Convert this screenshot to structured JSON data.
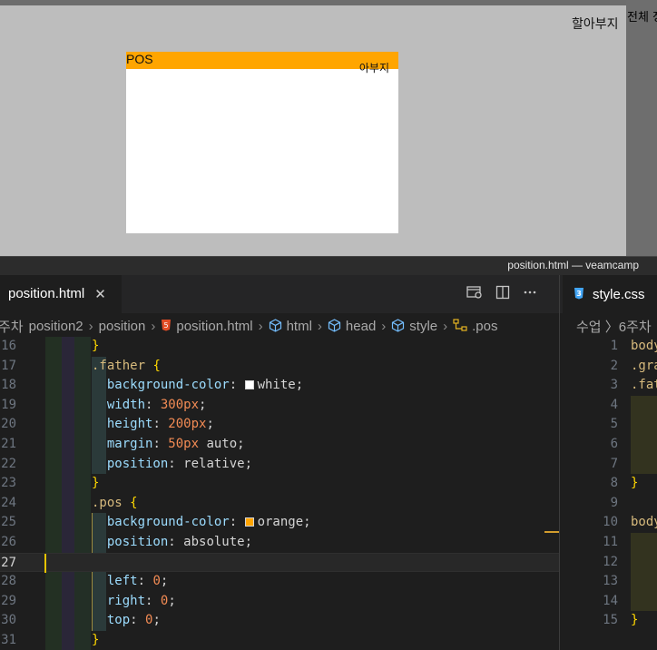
{
  "preview": {
    "top_right_text": "할아부지",
    "right_panel_text": "전체 정",
    "pos_label": "POS",
    "pos_overlap_text": "아부지"
  },
  "window": {
    "title": "position.html — veamcamp"
  },
  "tabs": {
    "active": {
      "label": "position.html",
      "close_glyph": "✕"
    },
    "other": {
      "label": "style.css"
    }
  },
  "breadcrumb": {
    "items": [
      "주차",
      "position2",
      "position",
      "position.html",
      "html",
      "head",
      "style",
      ".pos"
    ]
  },
  "breadcrumb_right": {
    "text": "수업 〉6주차"
  },
  "code_left": {
    "line_numbers": [
      "16",
      "17",
      "18",
      "19",
      "20",
      "21",
      "22",
      "23",
      "24",
      "25",
      "26",
      "27",
      "28",
      "29",
      "30",
      "31"
    ],
    "line16": "}",
    "line17_selector": ".father",
    "line17_brace": "{",
    "line18_prop": "background-color",
    "line18_val": "white",
    "line19_prop": "width",
    "line19_val": "300px",
    "line20_prop": "height",
    "line20_val": "200px",
    "line21_prop": "margin",
    "line21_num": "50px",
    "line21_val": "auto",
    "line22_prop": "position",
    "line22_val": "relative",
    "line23": "}",
    "line24_selector": ".pos",
    "line24_brace": "{",
    "line25_prop": "background-color",
    "line25_val": "orange",
    "line26_prop": "position",
    "line26_val": "absolute",
    "line28_prop": "left",
    "line28_val": "0",
    "line29_prop": "right",
    "line29_val": "0",
    "line30_prop": "top",
    "line30_val": "0",
    "line31": "}"
  },
  "code_right": {
    "line_numbers": [
      "1",
      "2",
      "3",
      "4",
      "5",
      "6",
      "7",
      "8",
      "9",
      "10",
      "11",
      "12",
      "13",
      "14",
      "15"
    ],
    "line1": "body",
    "line2": ".gra",
    "line3": ".fat",
    "line8": "}",
    "line10": "body",
    "line15": "}"
  },
  "colors": {
    "orange": "#ffa500",
    "white": "#ffffff",
    "editor_bg": "#1e1e1e",
    "preview_bg": "#bdbdbd"
  }
}
